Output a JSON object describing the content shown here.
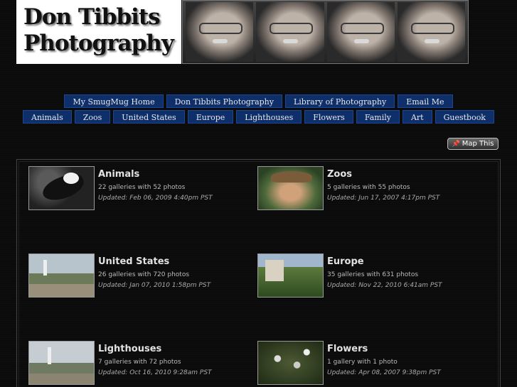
{
  "header": {
    "logo_line1": "Don Tibbits",
    "logo_line2": "Photography"
  },
  "nav": {
    "row1": [
      "My SmugMug Home",
      "Don Tibbits Photography",
      "Library of Photography",
      "Email Me"
    ],
    "row2": [
      "Animals",
      "Zoos",
      "United States",
      "Europe",
      "Lighthouses",
      "Flowers",
      "Family",
      "Art",
      "Guestbook"
    ],
    "accent": "#0e2f6a"
  },
  "map_button": {
    "label": "Map This",
    "icon": "pin-icon"
  },
  "categories": [
    {
      "title": "Animals",
      "summary": "22 galleries with 52 photos",
      "updated": "Updated: Feb 06, 2009 4:40pm PST"
    },
    {
      "title": "Zoos",
      "summary": "5 galleries with 55 photos",
      "updated": "Updated: Jun 17, 2007 4:17pm PST"
    },
    {
      "title": "United States",
      "summary": "26 galleries with 720 photos",
      "updated": "Updated: Jan 07, 2010 1:58pm PST"
    },
    {
      "title": "Europe",
      "summary": "35 galleries with 631 photos",
      "updated": "Updated: Nov 22, 2010 6:41am PST"
    },
    {
      "title": "Lighthouses",
      "summary": "7 galleries with 72 photos",
      "updated": "Updated: Oct 16, 2010 9:28am PST"
    },
    {
      "title": "Flowers",
      "summary": "1 gallery with 1 photo",
      "updated": "Updated: Apr 08, 2007 9:38pm PST"
    }
  ]
}
